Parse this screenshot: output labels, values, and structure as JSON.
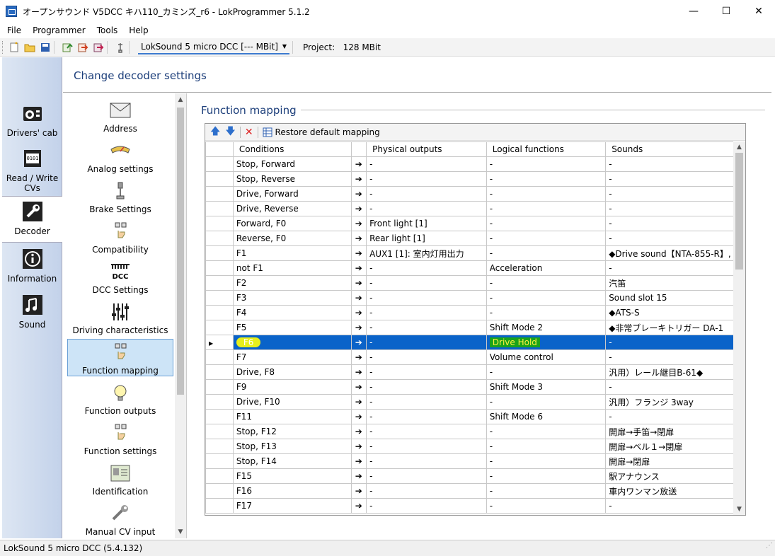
{
  "window": {
    "title": "オープンサウンド V5DCC キハ110_カミンズ_r6 - LokProgrammer 5.1.2",
    "controls": [
      "—",
      "☐",
      "✕"
    ]
  },
  "menu": [
    "File",
    "Programmer",
    "Tools",
    "Help"
  ],
  "toolbar": {
    "decoder": "LokSound 5 micro DCC [--- MBit]",
    "project_label": "Project:",
    "project_value": "128 MBit"
  },
  "leftnav": [
    {
      "label": "Drivers' cab",
      "icon": "radio-icon"
    },
    {
      "label": "Read / Write CVs",
      "icon": "chip-icon"
    },
    {
      "label": "Decoder",
      "icon": "wrench-icon",
      "active": true
    },
    {
      "label": "Information",
      "icon": "info-icon"
    },
    {
      "label": "Sound",
      "icon": "music-icon"
    }
  ],
  "header": {
    "title": "Change decoder settings"
  },
  "settings": [
    {
      "label": "Address",
      "icon": "envelope-icon"
    },
    {
      "label": "Analog settings",
      "icon": "gauge-icon"
    },
    {
      "label": "Brake Settings",
      "icon": "brake-icon"
    },
    {
      "label": "Compatibility",
      "icon": "hand-keys-icon"
    },
    {
      "label": "DCC Settings",
      "icon": "dcc-icon"
    },
    {
      "label": "Driving characteristics",
      "icon": "sliders-icon"
    },
    {
      "label": "Function mapping",
      "icon": "hand-keys-icon",
      "selected": true
    },
    {
      "label": "Function outputs",
      "icon": "lightbulb-icon"
    },
    {
      "label": "Function settings",
      "icon": "hand-keys-icon"
    },
    {
      "label": "Identification",
      "icon": "id-card-icon"
    },
    {
      "label": "Manual CV input",
      "icon": "wrench-small-icon"
    }
  ],
  "function_mapping": {
    "section_title": "Function mapping",
    "restore_label": "Restore default mapping",
    "columns": [
      "Conditions",
      "Physical outputs",
      "Logical functions",
      "Sounds"
    ],
    "rows": [
      {
        "cond": "Stop, Forward",
        "phys": "-",
        "logic": "-",
        "sound": "-"
      },
      {
        "cond": "Stop, Reverse",
        "phys": "-",
        "logic": "-",
        "sound": "-"
      },
      {
        "cond": "Drive, Forward",
        "phys": "-",
        "logic": "-",
        "sound": "-"
      },
      {
        "cond": "Drive, Reverse",
        "phys": "-",
        "logic": "-",
        "sound": "-"
      },
      {
        "cond": "Forward, F0",
        "phys": "Front light [1]",
        "logic": "-",
        "sound": "-"
      },
      {
        "cond": "Reverse, F0",
        "phys": "Rear light [1]",
        "logic": "-",
        "sound": "-"
      },
      {
        "cond": "F1",
        "phys": "AUX1 [1]: 室内灯用出力",
        "logic": "-",
        "sound": "◆Drive sound【NTA-855-R】, ..."
      },
      {
        "cond": "not F1",
        "phys": "-",
        "logic": "Acceleration",
        "sound": "-"
      },
      {
        "cond": "F2",
        "phys": "-",
        "logic": "-",
        "sound": "汽笛"
      },
      {
        "cond": "F3",
        "phys": "-",
        "logic": "-",
        "sound": "Sound slot 15"
      },
      {
        "cond": "F4",
        "phys": "-",
        "logic": "-",
        "sound": "◆ATS-S"
      },
      {
        "cond": "F5",
        "phys": "-",
        "logic": "Shift Mode 2",
        "sound": "◆非常ブレーキトリガー DA-1"
      },
      {
        "cond": "F6",
        "phys": "-",
        "logic": "Drive Hold",
        "sound": "-",
        "selected": true
      },
      {
        "cond": "F7",
        "phys": "-",
        "logic": "Volume control",
        "sound": "-"
      },
      {
        "cond": "Drive, F8",
        "phys": "-",
        "logic": "-",
        "sound": "汎用）レール継目B-61◆"
      },
      {
        "cond": "F9",
        "phys": "-",
        "logic": "Shift Mode 3",
        "sound": "-"
      },
      {
        "cond": "Drive, F10",
        "phys": "-",
        "logic": "-",
        "sound": "汎用）フランジ 3way"
      },
      {
        "cond": "F11",
        "phys": "-",
        "logic": "Shift Mode 6",
        "sound": "-"
      },
      {
        "cond": "Stop, F12",
        "phys": "-",
        "logic": "-",
        "sound": "開扉→手笛→閉扉"
      },
      {
        "cond": "Stop, F13",
        "phys": "-",
        "logic": "-",
        "sound": "開扉→ベル１→閉扉"
      },
      {
        "cond": "Stop, F14",
        "phys": "-",
        "logic": "-",
        "sound": "開扉→閉扉"
      },
      {
        "cond": "F15",
        "phys": "-",
        "logic": "-",
        "sound": "駅アナウンス"
      },
      {
        "cond": "F16",
        "phys": "-",
        "logic": "-",
        "sound": "車内ワンマン放送"
      },
      {
        "cond": "F17",
        "phys": "-",
        "logic": "-",
        "sound": "-"
      }
    ]
  },
  "status": {
    "text": "LokSound 5 micro DCC (5.4.132)"
  },
  "colors": {
    "selection": "#0a63c9",
    "accent": "#1c3e7a",
    "highlight_yellow": "#e6ef1a",
    "highlight_green": "#1aa31a"
  }
}
